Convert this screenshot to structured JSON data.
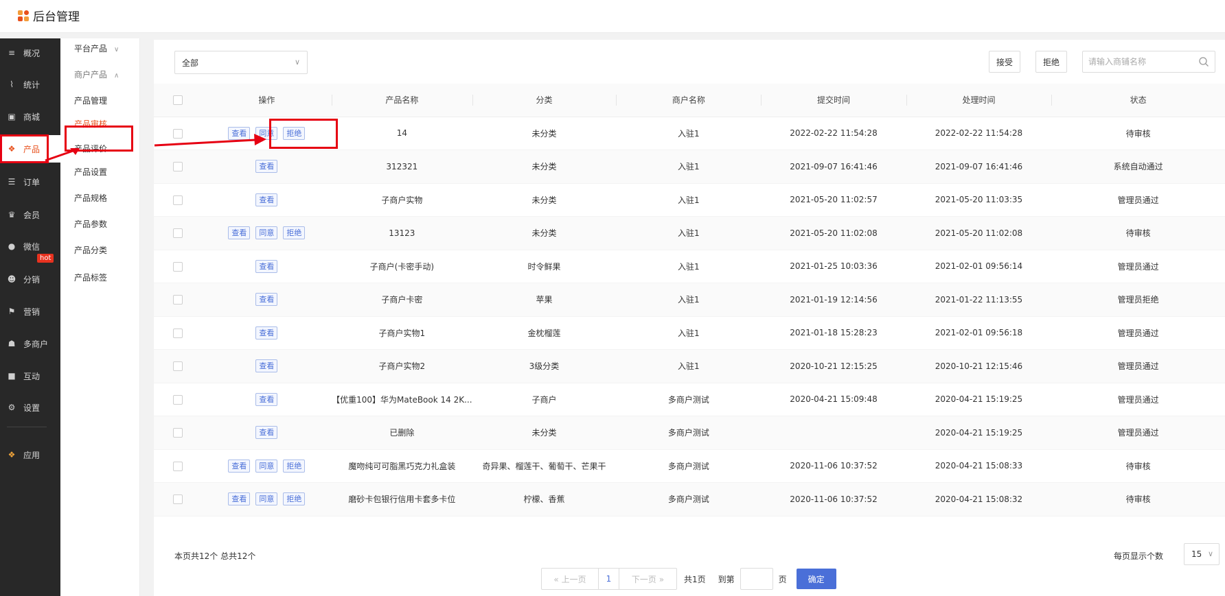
{
  "app": {
    "title": "后台管理"
  },
  "colors": {
    "accent": "#e8501c",
    "primary": "#4a6fd8",
    "highlight": "#e60012",
    "nav_bg": "#282828"
  },
  "nav": {
    "items": [
      {
        "label": "概况",
        "icon": "layers-icon"
      },
      {
        "label": "统计",
        "icon": "chart-icon"
      },
      {
        "label": "商城",
        "icon": "store-icon"
      },
      {
        "label": "产品",
        "icon": "grid-icon",
        "active": true
      },
      {
        "label": "订单",
        "icon": "order-icon"
      },
      {
        "label": "会员",
        "icon": "crown-icon"
      },
      {
        "label": "微信",
        "icon": "wechat-icon"
      },
      {
        "label": "分销",
        "icon": "users-icon"
      },
      {
        "label": "营销",
        "icon": "flag-icon",
        "badge": "hot"
      },
      {
        "label": "多商户",
        "icon": "merchant-icon"
      },
      {
        "label": "互动",
        "icon": "interact-icon"
      },
      {
        "label": "设置",
        "icon": "gear-icon"
      },
      {
        "label": "应用",
        "icon": "apps-icon"
      }
    ]
  },
  "subnav": {
    "platform_group": "平台产品",
    "merchant_group": "商户产品",
    "items": [
      "产品管理",
      "产品审核",
      "产品评价",
      "产品设置",
      "产品规格",
      "产品参数",
      "产品分类",
      "产品标签"
    ],
    "active": "产品审核"
  },
  "toolbar": {
    "filter_value": "全部",
    "accept_label": "接受",
    "reject_label": "拒绝",
    "search_placeholder": "请输入商铺名称"
  },
  "table": {
    "headers": [
      "操作",
      "产品名称",
      "分类",
      "商户名称",
      "提交时间",
      "处理时间",
      "状态"
    ],
    "action_labels": {
      "view": "查看",
      "approve": "同意",
      "reject": "拒绝"
    },
    "rows": [
      {
        "actions": [
          "查看",
          "同意",
          "拒绝"
        ],
        "name": "14",
        "category": "未分类",
        "merchant": "入驻1",
        "submitted": "2022-02-22 11:54:28",
        "processed": "2022-02-22 11:54:28",
        "status": "待审核"
      },
      {
        "actions": [
          "查看"
        ],
        "name": "312321",
        "category": "未分类",
        "merchant": "入驻1",
        "submitted": "2021-09-07 16:41:46",
        "processed": "2021-09-07 16:41:46",
        "status": "系统自动通过"
      },
      {
        "actions": [
          "查看"
        ],
        "name": "子商户实物",
        "category": "未分类",
        "merchant": "入驻1",
        "submitted": "2021-05-20 11:02:57",
        "processed": "2021-05-20 11:03:35",
        "status": "管理员通过"
      },
      {
        "actions": [
          "查看",
          "同意",
          "拒绝"
        ],
        "name": "13123",
        "category": "未分类",
        "merchant": "入驻1",
        "submitted": "2021-05-20 11:02:08",
        "processed": "2021-05-20 11:02:08",
        "status": "待审核"
      },
      {
        "actions": [
          "查看"
        ],
        "name": "子商户(卡密手动)",
        "category": "时令鲜果",
        "merchant": "入驻1",
        "submitted": "2021-01-25 10:03:36",
        "processed": "2021-02-01 09:56:14",
        "status": "管理员通过"
      },
      {
        "actions": [
          "查看"
        ],
        "name": "子商户卡密",
        "category": "苹果",
        "merchant": "入驻1",
        "submitted": "2021-01-19 12:14:56",
        "processed": "2021-01-22 11:13:55",
        "status": "管理员拒绝"
      },
      {
        "actions": [
          "查看"
        ],
        "name": "子商户实物1",
        "category": "金枕榴莲",
        "merchant": "入驻1",
        "submitted": "2021-01-18 15:28:23",
        "processed": "2021-02-01 09:56:18",
        "status": "管理员通过"
      },
      {
        "actions": [
          "查看"
        ],
        "name": "子商户实物2",
        "category": "3级分类",
        "merchant": "入驻1",
        "submitted": "2020-10-21 12:15:25",
        "processed": "2020-10-21 12:15:46",
        "status": "管理员通过"
      },
      {
        "actions": [
          "查看"
        ],
        "name": "【优重100】华为MateBook 14 2K...",
        "category": "子商户",
        "merchant": "多商户测试",
        "submitted": "2020-04-21 15:09:48",
        "processed": "2020-04-21 15:19:25",
        "status": "管理员通过"
      },
      {
        "actions": [
          "查看"
        ],
        "name": "已删除",
        "category": "未分类",
        "merchant": "多商户测试",
        "submitted": "",
        "processed": "2020-04-21 15:19:25",
        "status": "管理员通过"
      },
      {
        "actions": [
          "查看",
          "同意",
          "拒绝"
        ],
        "name": "魔吻纯可可脂黑巧克力礼盒装",
        "category": "奇异果、榴莲干、葡萄干、芒果干",
        "merchant": "多商户测试",
        "submitted": "2020-11-06 10:37:52",
        "processed": "2020-04-21 15:08:33",
        "status": "待审核"
      },
      {
        "actions": [
          "查看",
          "同意",
          "拒绝"
        ],
        "name": "磨砂卡包银行信用卡套多卡位",
        "category": "柠檬、香蕉",
        "merchant": "多商户测试",
        "submitted": "2020-11-06 10:37:52",
        "processed": "2020-04-21 15:08:32",
        "status": "待审核"
      }
    ]
  },
  "footer": {
    "summary": "本页共12个  总共12个",
    "per_page_label": "每页显示个数",
    "per_page_value": "15",
    "prev_label": "« 上一页",
    "next_label": "下一页 »",
    "current_page": "1",
    "total_pages": "共1页",
    "goto_label": "到第",
    "page_unit": "页",
    "confirm_label": "确定"
  }
}
